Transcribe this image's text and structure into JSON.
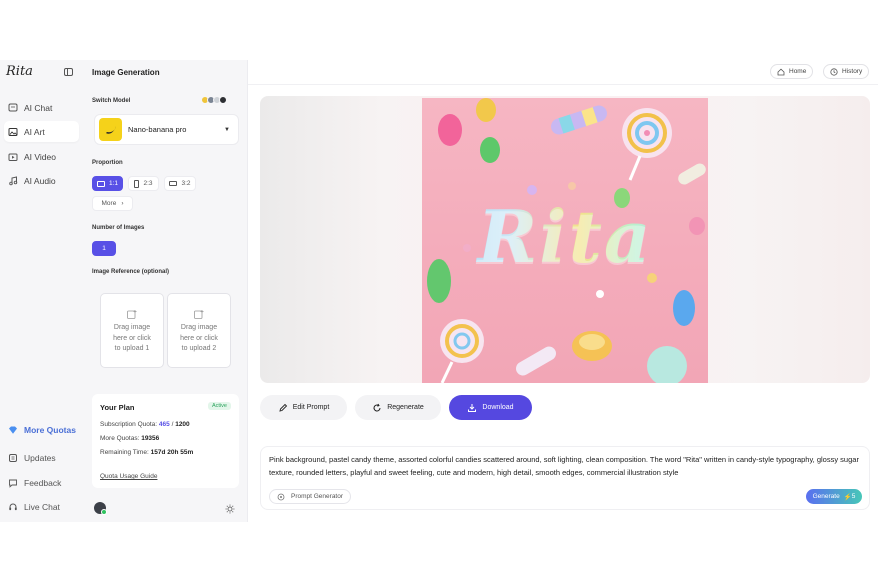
{
  "brand": {
    "logo_text": "Rita"
  },
  "nav": {
    "items": [
      {
        "label": "AI Chat",
        "icon": "chat-icon",
        "active": false
      },
      {
        "label": "AI Art",
        "icon": "image-icon",
        "active": true
      },
      {
        "label": "AI Video",
        "icon": "video-icon",
        "active": false
      },
      {
        "label": "AI Audio",
        "icon": "music-icon",
        "active": false
      }
    ],
    "bottom": [
      {
        "label": "More Quotas",
        "icon": "diamond-icon"
      },
      {
        "label": "Updates",
        "icon": "updates-icon"
      },
      {
        "label": "Feedback",
        "icon": "feedback-icon"
      },
      {
        "label": "Live Chat",
        "icon": "headset-icon"
      }
    ]
  },
  "panel": {
    "title": "Image Generation",
    "switch_model_label": "Switch Model",
    "model_name": "Nano-banana pro",
    "proportion_label": "Proportion",
    "proportions": [
      "1:1",
      "2:3",
      "3:2"
    ],
    "selected_proportion": "1:1",
    "more_label": "More",
    "num_images_label": "Number of Images",
    "num_images": "1",
    "reference_label": "Image Reference (optional)",
    "upload_slots": [
      {
        "line1": "Drag image",
        "line2": "here or click",
        "line3": "to upload 1"
      },
      {
        "line1": "Drag image",
        "line2": "here or click",
        "line3": "to upload 2"
      }
    ]
  },
  "plan": {
    "title": "Your Plan",
    "status": "Active",
    "subscription_label": "Subscription Quota:",
    "subscription_used": "465",
    "subscription_sep": "/",
    "subscription_total": "1200",
    "more_quotas_label": "More Quotas:",
    "more_quotas_value": "19356",
    "remaining_label": "Remaining Time:",
    "remaining_value": "157d 20h 55m",
    "guide_link": "Quota Usage Guide"
  },
  "topbar": {
    "home": "Home",
    "history": "History"
  },
  "canvas": {
    "art_text": "Rita"
  },
  "actions": {
    "edit": "Edit Prompt",
    "regenerate": "Regenerate",
    "download": "Download"
  },
  "prompt": {
    "text": "Pink background, pastel candy theme, assorted colorful candies scattered around, soft lighting, clean composition. The word \"Rita\" written in candy-style typography, glossy sugar texture, rounded letters, playful and sweet feeling, cute and modern, high detail, smooth edges, commercial illustration style",
    "generator_label": "Prompt Generator",
    "generate_label": "Generate",
    "generate_cost": "5"
  },
  "colors": {
    "accent": "#5850e6",
    "active_badge": "#2aa35d",
    "quota_link": "#4a6fd6"
  }
}
